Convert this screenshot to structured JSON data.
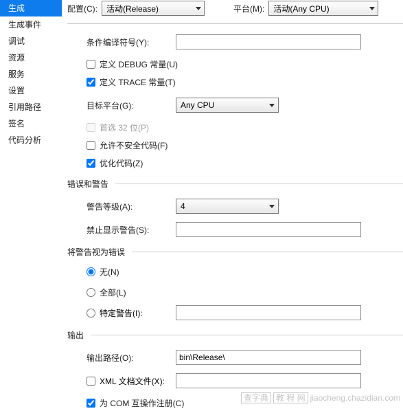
{
  "sidebar": {
    "items": [
      {
        "label": "生成",
        "active": true
      },
      {
        "label": "生成事件"
      },
      {
        "label": "调试"
      },
      {
        "label": "资源"
      },
      {
        "label": "服务"
      },
      {
        "label": "设置"
      },
      {
        "label": "引用路径"
      },
      {
        "label": "签名"
      },
      {
        "label": "代码分析"
      }
    ]
  },
  "top": {
    "configLabel": "配置(C):",
    "configValue": "活动(Release)",
    "platformLabel": "平台(M):",
    "platformValue": "活动(Any CPU)"
  },
  "general": {
    "symbolsLabel": "条件编译符号(Y):",
    "symbolsValue": "",
    "defineDebug": "定义 DEBUG 常量(U)",
    "defineTrace": "定义 TRACE 常量(T)",
    "targetLabel": "目标平台(G):",
    "targetValue": "Any CPU",
    "prefer32": "首选 32 位(P)",
    "allowUnsafe": "允许不安全代码(F)",
    "optimize": "优化代码(Z)"
  },
  "errors": {
    "section": "错误和警告",
    "warnLevelLabel": "警告等级(A):",
    "warnLevelValue": "4",
    "suppressLabel": "禁止显示警告(S):",
    "suppressValue": ""
  },
  "treat": {
    "section": "将警告视为错误",
    "none": "无(N)",
    "all": "全部(L)",
    "specificLabel": "特定警告(I):",
    "specificValue": ""
  },
  "output": {
    "section": "输出",
    "pathLabel": "输出路径(O):",
    "pathValue": "bin\\Release\\",
    "xmlDocLabel": "XML 文档文件(X):",
    "xmlDocValue": "",
    "comInterop": "为 COM 互操作注册(C)"
  },
  "watermark": {
    "left": "查字典",
    "mid": "教 程 网",
    "right": "jiaocheng.chazidian.com"
  }
}
